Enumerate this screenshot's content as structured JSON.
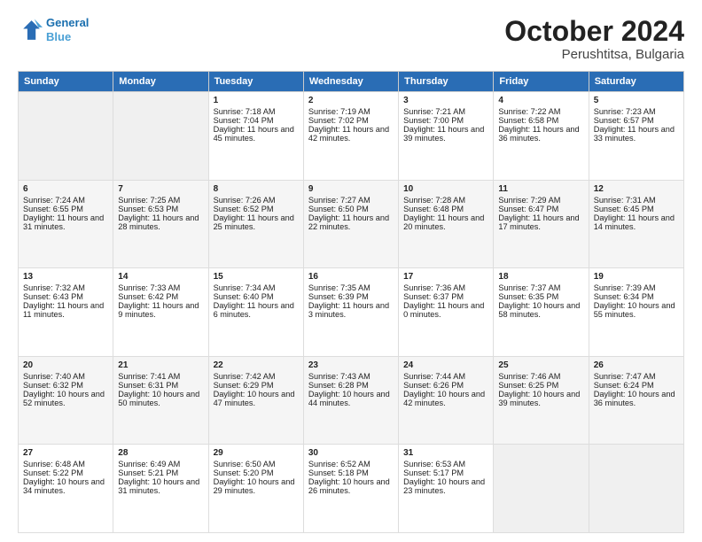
{
  "logo": {
    "line1": "General",
    "line2": "Blue"
  },
  "title": "October 2024",
  "location": "Perushtitsa, Bulgaria",
  "headers": [
    "Sunday",
    "Monday",
    "Tuesday",
    "Wednesday",
    "Thursday",
    "Friday",
    "Saturday"
  ],
  "weeks": [
    [
      {
        "day": "",
        "content": ""
      },
      {
        "day": "",
        "content": ""
      },
      {
        "day": "1",
        "content": "Sunrise: 7:18 AM\nSunset: 7:04 PM\nDaylight: 11 hours and 45 minutes."
      },
      {
        "day": "2",
        "content": "Sunrise: 7:19 AM\nSunset: 7:02 PM\nDaylight: 11 hours and 42 minutes."
      },
      {
        "day": "3",
        "content": "Sunrise: 7:21 AM\nSunset: 7:00 PM\nDaylight: 11 hours and 39 minutes."
      },
      {
        "day": "4",
        "content": "Sunrise: 7:22 AM\nSunset: 6:58 PM\nDaylight: 11 hours and 36 minutes."
      },
      {
        "day": "5",
        "content": "Sunrise: 7:23 AM\nSunset: 6:57 PM\nDaylight: 11 hours and 33 minutes."
      }
    ],
    [
      {
        "day": "6",
        "content": "Sunrise: 7:24 AM\nSunset: 6:55 PM\nDaylight: 11 hours and 31 minutes."
      },
      {
        "day": "7",
        "content": "Sunrise: 7:25 AM\nSunset: 6:53 PM\nDaylight: 11 hours and 28 minutes."
      },
      {
        "day": "8",
        "content": "Sunrise: 7:26 AM\nSunset: 6:52 PM\nDaylight: 11 hours and 25 minutes."
      },
      {
        "day": "9",
        "content": "Sunrise: 7:27 AM\nSunset: 6:50 PM\nDaylight: 11 hours and 22 minutes."
      },
      {
        "day": "10",
        "content": "Sunrise: 7:28 AM\nSunset: 6:48 PM\nDaylight: 11 hours and 20 minutes."
      },
      {
        "day": "11",
        "content": "Sunrise: 7:29 AM\nSunset: 6:47 PM\nDaylight: 11 hours and 17 minutes."
      },
      {
        "day": "12",
        "content": "Sunrise: 7:31 AM\nSunset: 6:45 PM\nDaylight: 11 hours and 14 minutes."
      }
    ],
    [
      {
        "day": "13",
        "content": "Sunrise: 7:32 AM\nSunset: 6:43 PM\nDaylight: 11 hours and 11 minutes."
      },
      {
        "day": "14",
        "content": "Sunrise: 7:33 AM\nSunset: 6:42 PM\nDaylight: 11 hours and 9 minutes."
      },
      {
        "day": "15",
        "content": "Sunrise: 7:34 AM\nSunset: 6:40 PM\nDaylight: 11 hours and 6 minutes."
      },
      {
        "day": "16",
        "content": "Sunrise: 7:35 AM\nSunset: 6:39 PM\nDaylight: 11 hours and 3 minutes."
      },
      {
        "day": "17",
        "content": "Sunrise: 7:36 AM\nSunset: 6:37 PM\nDaylight: 11 hours and 0 minutes."
      },
      {
        "day": "18",
        "content": "Sunrise: 7:37 AM\nSunset: 6:35 PM\nDaylight: 10 hours and 58 minutes."
      },
      {
        "day": "19",
        "content": "Sunrise: 7:39 AM\nSunset: 6:34 PM\nDaylight: 10 hours and 55 minutes."
      }
    ],
    [
      {
        "day": "20",
        "content": "Sunrise: 7:40 AM\nSunset: 6:32 PM\nDaylight: 10 hours and 52 minutes."
      },
      {
        "day": "21",
        "content": "Sunrise: 7:41 AM\nSunset: 6:31 PM\nDaylight: 10 hours and 50 minutes."
      },
      {
        "day": "22",
        "content": "Sunrise: 7:42 AM\nSunset: 6:29 PM\nDaylight: 10 hours and 47 minutes."
      },
      {
        "day": "23",
        "content": "Sunrise: 7:43 AM\nSunset: 6:28 PM\nDaylight: 10 hours and 44 minutes."
      },
      {
        "day": "24",
        "content": "Sunrise: 7:44 AM\nSunset: 6:26 PM\nDaylight: 10 hours and 42 minutes."
      },
      {
        "day": "25",
        "content": "Sunrise: 7:46 AM\nSunset: 6:25 PM\nDaylight: 10 hours and 39 minutes."
      },
      {
        "day": "26",
        "content": "Sunrise: 7:47 AM\nSunset: 6:24 PM\nDaylight: 10 hours and 36 minutes."
      }
    ],
    [
      {
        "day": "27",
        "content": "Sunrise: 6:48 AM\nSunset: 5:22 PM\nDaylight: 10 hours and 34 minutes."
      },
      {
        "day": "28",
        "content": "Sunrise: 6:49 AM\nSunset: 5:21 PM\nDaylight: 10 hours and 31 minutes."
      },
      {
        "day": "29",
        "content": "Sunrise: 6:50 AM\nSunset: 5:20 PM\nDaylight: 10 hours and 29 minutes."
      },
      {
        "day": "30",
        "content": "Sunrise: 6:52 AM\nSunset: 5:18 PM\nDaylight: 10 hours and 26 minutes."
      },
      {
        "day": "31",
        "content": "Sunrise: 6:53 AM\nSunset: 5:17 PM\nDaylight: 10 hours and 23 minutes."
      },
      {
        "day": "",
        "content": ""
      },
      {
        "day": "",
        "content": ""
      }
    ]
  ]
}
